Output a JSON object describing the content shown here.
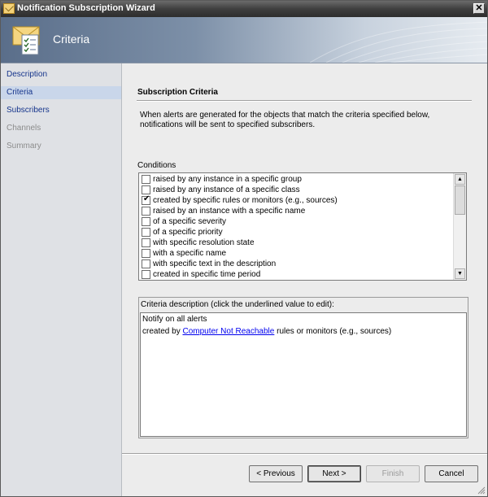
{
  "window": {
    "title": "Notification Subscription Wizard",
    "close_label": "✕"
  },
  "banner": {
    "title": "Criteria"
  },
  "nav": {
    "items": [
      {
        "label": "Description",
        "state": "link"
      },
      {
        "label": "Criteria",
        "state": "active"
      },
      {
        "label": "Subscribers",
        "state": "link"
      },
      {
        "label": "Channels",
        "state": "disabled"
      },
      {
        "label": "Summary",
        "state": "disabled"
      }
    ]
  },
  "main": {
    "section_title": "Subscription Criteria",
    "intro_line1": "When alerts are generated for the objects that match the criteria specified below,",
    "intro_line2": "notifications will be sent to specified subscribers.",
    "conditions_label": "Conditions",
    "conditions": [
      {
        "label": "raised by any instance in a specific group",
        "checked": false
      },
      {
        "label": "raised by any instance of a specific class",
        "checked": false
      },
      {
        "label": "created by specific rules or monitors (e.g., sources)",
        "checked": true
      },
      {
        "label": "raised by an instance with a specific name",
        "checked": false
      },
      {
        "label": "of a specific severity",
        "checked": false
      },
      {
        "label": "of a specific priority",
        "checked": false
      },
      {
        "label": "with specific resolution state",
        "checked": false
      },
      {
        "label": "with a specific name",
        "checked": false
      },
      {
        "label": "with specific text in the description",
        "checked": false
      },
      {
        "label": "created in specific time period",
        "checked": false
      }
    ],
    "criteria_desc_label": "Criteria description (click the underlined value to edit):",
    "criteria_line1": "Notify on all alerts",
    "criteria_line2_prefix": "created by",
    "criteria_line2_link": "Computer Not Reachable",
    "criteria_line2_suffix": "rules or monitors (e.g., sources)"
  },
  "footer": {
    "previous": "< Previous",
    "next": "Next >",
    "finish": "Finish",
    "cancel": "Cancel"
  },
  "colors": {
    "link": "#16358c",
    "active_nav": "#c9d6ea",
    "hyperlink": "#0000ee"
  }
}
